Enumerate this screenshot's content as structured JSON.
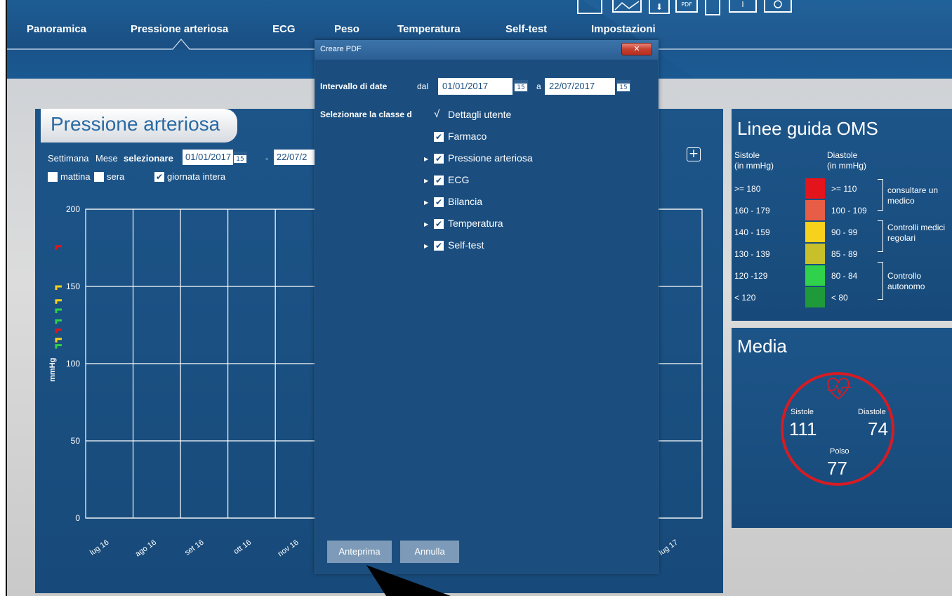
{
  "nav": {
    "items": [
      {
        "label": "Panoramica"
      },
      {
        "label": "Pressione arteriosa"
      },
      {
        "label": "ECG"
      },
      {
        "label": "Peso"
      },
      {
        "label": "Temperatura"
      },
      {
        "label": "Self-test"
      },
      {
        "label": "Impostazioni"
      }
    ],
    "active": "Pressione arteriosa",
    "toolbar_icons": [
      "print-icon",
      "chart-icon",
      "download-icon",
      "pdf-icon",
      "list-icon",
      "info-icon",
      "circle-icon"
    ],
    "pdf_icon_label": "PDF"
  },
  "bp_panel": {
    "title": "Pressione arteriosa",
    "period_week": "Settimana",
    "period_month": "Mese",
    "select_label": "selezionare",
    "date_from": "01/01/2017",
    "date_to": "22/07/2",
    "dash": "-",
    "cal_day": "15",
    "filters": [
      {
        "label": "mattina",
        "checked": false
      },
      {
        "label": "sera",
        "checked": false
      },
      {
        "label": "giornata intera",
        "checked": true
      }
    ],
    "add_icon": "plus-icon"
  },
  "chart_data": {
    "type": "line",
    "title": "",
    "xlabel": "",
    "ylabel": "mmHg",
    "ylim": [
      0,
      200
    ],
    "yticks": [
      "200",
      "150",
      "100",
      "50",
      "0"
    ],
    "categories": [
      "lug 16",
      "ago 16",
      "set 16",
      "ott 16",
      "nov 16",
      "lug 17"
    ],
    "grid": true,
    "series": []
  },
  "oms": {
    "title": "Linee guida OMS",
    "col1": "Sistole",
    "col1_unit": "(in mmHg)",
    "col2": "Diastole",
    "col2_unit": "(in mmHg)",
    "rows": [
      {
        "systolic": ">= 180",
        "diastolic": ">= 110",
        "color": "#e3141b"
      },
      {
        "systolic": "160 - 179",
        "diastolic": "100 - 109",
        "color": "#e85d45"
      },
      {
        "systolic": "140 - 159",
        "diastolic": "90 - 99",
        "color": "#f7d11b"
      },
      {
        "systolic": "130 - 139",
        "diastolic": "85 - 89",
        "color": "#c7c02b"
      },
      {
        "systolic": "120 -129",
        "diastolic": "80 - 84",
        "color": "#2fd24a"
      },
      {
        "systolic": "< 120",
        "diastolic": "< 80",
        "color": "#1f9a3a"
      }
    ],
    "notes": [
      "consultare un medico",
      "Controlli medici regolari",
      "Controllo autonomo"
    ]
  },
  "media": {
    "title": "Media",
    "systolic_label": "Sistole",
    "systolic_value": "111",
    "diastolic_label": "Diastole",
    "diastolic_value": "74",
    "pulse_label": "Polso",
    "pulse_value": "77",
    "icon": "heart-icon"
  },
  "modal": {
    "title": "Creare PDF",
    "close_icon": "close-icon",
    "date_range_label": "Intervallo di date",
    "from_label": "dal",
    "from_value": "01/01/2017",
    "to_label": "a",
    "to_value": "22/07/2017",
    "cal_day": "15",
    "class_label": "Selezionare la classe d",
    "tree": [
      {
        "label": "Dettagli utente",
        "checked": true,
        "expandable": false,
        "plain_check": true
      },
      {
        "label": "Farmaco",
        "checked": true,
        "expandable": false
      },
      {
        "label": "Pressione arteriosa",
        "checked": true,
        "expandable": true
      },
      {
        "label": "ECG",
        "checked": true,
        "expandable": true
      },
      {
        "label": "Bilancia",
        "checked": true,
        "expandable": true
      },
      {
        "label": "Temperatura",
        "checked": true,
        "expandable": true
      },
      {
        "label": "Self-test",
        "checked": true,
        "expandable": true
      }
    ],
    "preview_button": "Anteprima",
    "cancel_button": "Annulla"
  },
  "colors": {
    "nav_bg": "#1b5590",
    "panel_bg": "#1b4f80",
    "accent_red": "#d51c24",
    "button_bg": "#7d9bb8"
  }
}
